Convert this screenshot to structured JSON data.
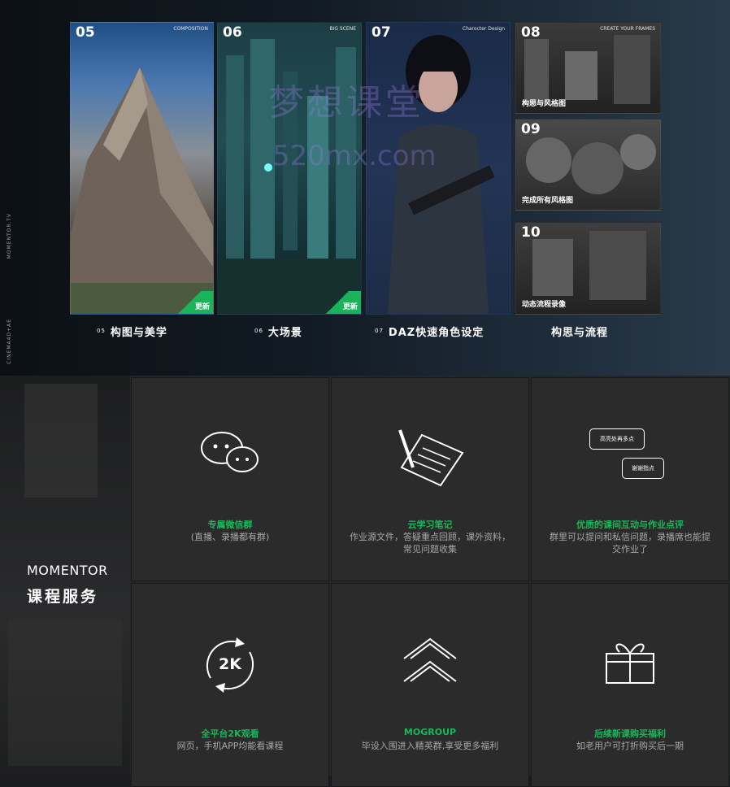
{
  "side": {
    "top_text": "MOMENTOR.TV",
    "bottom_text": "CINEMA4D+AE"
  },
  "watermark": {
    "line1": "梦想课堂",
    "line2": "520mx.com"
  },
  "cards": [
    {
      "num": "05",
      "tag": "COMPOSITION",
      "badge": "更新",
      "caption_num": "05",
      "caption": "构图与美学"
    },
    {
      "num": "06",
      "tag": "BIG SCENE",
      "badge": "更新",
      "caption_num": "06",
      "caption": "大场景"
    },
    {
      "num": "07",
      "tag": "Charocter Design",
      "caption_num": "07",
      "caption": "DAZ快速角色设定"
    }
  ],
  "right_cards": [
    {
      "num": "08",
      "tag": "CREATE YOUR FRAMES",
      "label": "构思与风格图"
    },
    {
      "num": "09",
      "label": "完成所有风格图"
    },
    {
      "num": "10",
      "label": "动态流程录像"
    }
  ],
  "right_caption": "构思与流程",
  "brand": {
    "title": "MOMENTOR",
    "subtitle": "课程服务"
  },
  "services": [
    {
      "icon": "wechat-icon",
      "title": "专属微信群",
      "desc": "(直播、录播都有群)"
    },
    {
      "icon": "notes-icon",
      "title": "云学习笔记",
      "desc": "作业源文件，答疑重点回顾，课外资料，常见问题收集"
    },
    {
      "icon": "chat-bubbles-icon",
      "title": "优质的课间互动与作业点评",
      "desc": "群里可以提问和私信问题，录播席也能提交作业了",
      "bubble1": "高亮处再多点",
      "bubble2": "谢谢指点"
    },
    {
      "icon": "refresh-2k-icon",
      "title": "全平台2K观看",
      "desc": "网页，手机APP均能看课程",
      "icon_text": "2K"
    },
    {
      "icon": "chevrons-up-icon",
      "title": "MOGROUP",
      "desc": "毕设入围进入精英群,享受更多福利"
    },
    {
      "icon": "gift-icon",
      "title": "后续新课购买福利",
      "desc": "如老用户可打折购买后一期"
    }
  ],
  "colors": {
    "accent_green": "#18b85a",
    "panel_bg": "#2b2b2b"
  }
}
